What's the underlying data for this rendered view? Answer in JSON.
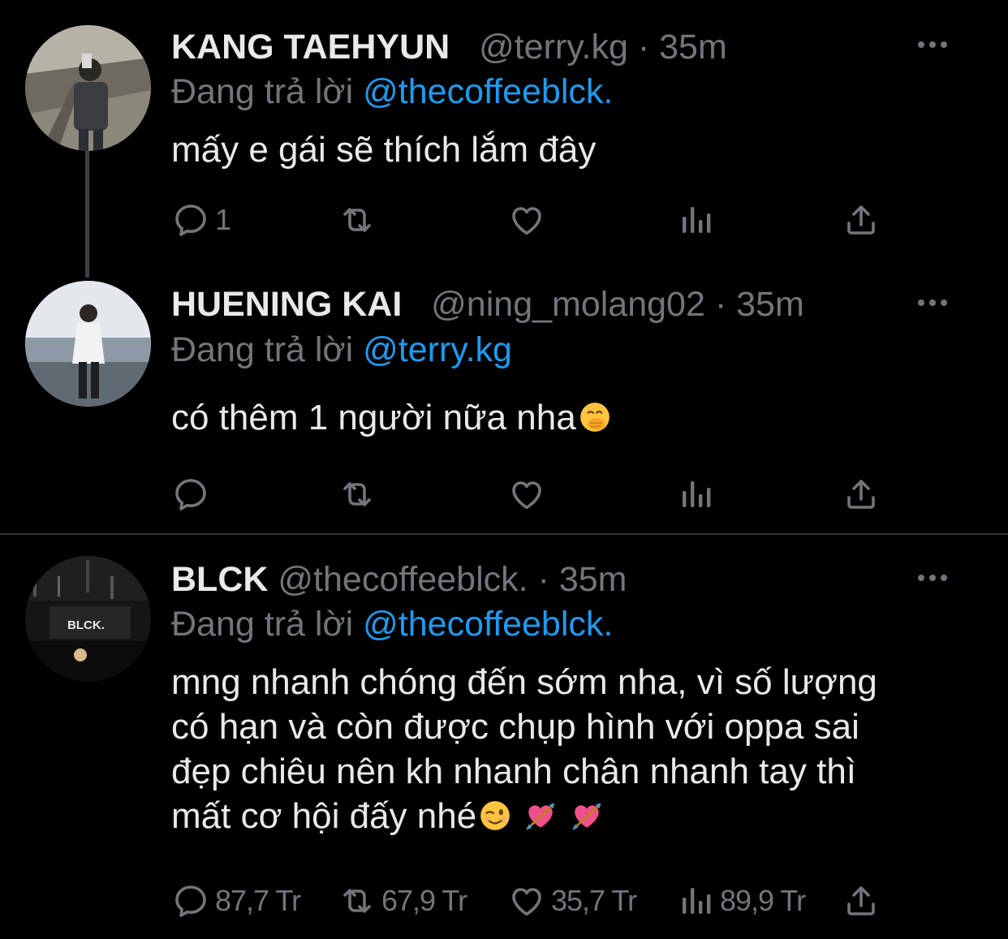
{
  "colors": {
    "background": "#000000",
    "name": "#e7e9ea",
    "meta": "#71767b",
    "mention": "#1d9bf0",
    "divider": "#2f3336"
  },
  "tweets": [
    {
      "display_name": "KANG TAEHYUN",
      "handle": "@terry.kg",
      "separator": "·",
      "time": "35m",
      "replying_prefix": "Đang trả lời",
      "replying_to": "@thecoffeeblck.",
      "text": "mấy e gái sẽ thích lắm đây",
      "actions": {
        "reply_count": "1",
        "retweet_count": "",
        "like_count": "",
        "views_count": ""
      },
      "icons": [
        "reply-icon",
        "retweet-icon",
        "like-icon",
        "views-icon",
        "share-icon",
        "more-icon"
      ]
    },
    {
      "display_name": "HUENING KAI",
      "handle": "@ning_molang02",
      "separator": "·",
      "time": "35m",
      "replying_prefix": "Đang trả lời",
      "replying_to": "@terry.kg",
      "text": "có thêm 1 người nữa nha",
      "emoji": "face-with-hand-over-mouth",
      "actions": {
        "reply_count": "",
        "retweet_count": "",
        "like_count": "",
        "views_count": ""
      }
    },
    {
      "display_name": "BLCK",
      "handle": "@thecoffeeblck.",
      "separator": "·",
      "time": "35m",
      "replying_prefix": "Đang trả lời",
      "replying_to": "@thecoffeeblck.",
      "text_lines": [
        "mng nhanh chóng đến sớm nha, vì số lượng",
        "có hạn và còn được chụp hình với oppa sai",
        "đẹp chiêu nên kh nhanh chân nhanh tay thì",
        "mất cơ hội đấy nhé"
      ],
      "emojis": [
        "winking-face",
        "heart-with-arrow",
        "heart-with-arrow"
      ],
      "avatar_sign_text": "BLCK.",
      "actions": {
        "reply_count": "87,7 Tr",
        "retweet_count": "67,9 Tr",
        "like_count": "35,7 Tr",
        "views_count": "89,9 Tr"
      }
    }
  ]
}
